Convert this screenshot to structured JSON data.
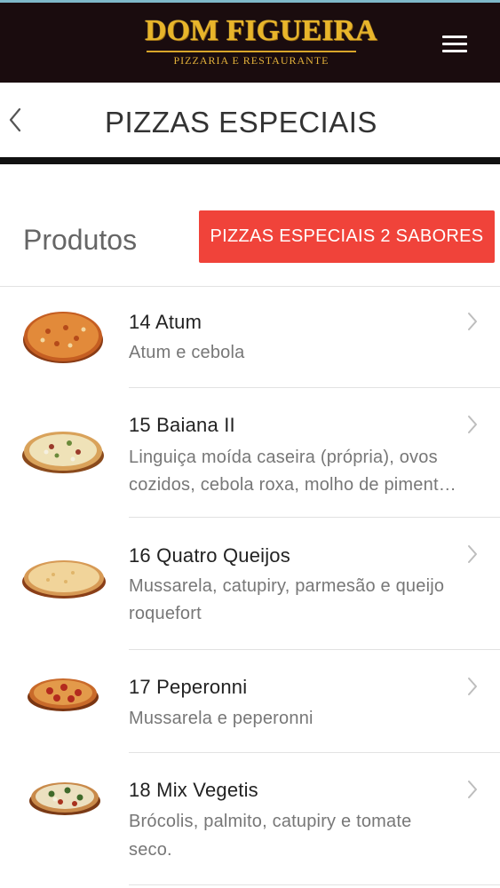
{
  "header": {
    "logo_main": "DOM FIGUEIRA",
    "logo_sub": "PIZZARIA E RESTAURANTE",
    "menu_icon": "hamburger-menu-icon",
    "bg_color": "#1a0c0e",
    "logo_color": "#e8b52a"
  },
  "titlebar": {
    "back_icon": "chevron-left-icon",
    "title": "PIZZAS ESPECIAIS"
  },
  "section": {
    "title": "Produtos",
    "tab_button_label": "PIZZAS ESPECIAIS 2 SABORES",
    "accent_color": "#f0433a"
  },
  "products": [
    {
      "name": "14 Atum",
      "description": "Atum e cebola",
      "thumb_icon": "pizza-image"
    },
    {
      "name": "15 Baiana II",
      "description_line1": "Linguiça moída caseira (própria), ovos",
      "description_line2": "cozidos, cebola roxa, molho de piment…",
      "thumb_icon": "pizza-image"
    },
    {
      "name": "16 Quatro Queijos",
      "description_line1": "Mussarela, catupiry, parmesão e queijo",
      "description_line2": "roquefort",
      "thumb_icon": "pizza-image"
    },
    {
      "name": "17 Peperonni",
      "description": "Mussarela e peperonni",
      "thumb_icon": "pizza-image"
    },
    {
      "name": "18 Mix Vegetis",
      "description_line1": "Brócolis, palmito, catupiry e tomate",
      "description_line2": "seco.",
      "thumb_icon": "pizza-image"
    }
  ]
}
